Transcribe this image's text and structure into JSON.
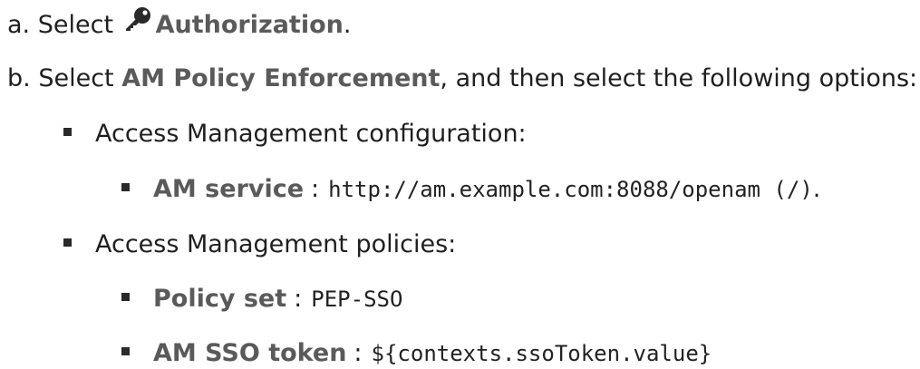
{
  "steps": {
    "a": {
      "marker": "a.",
      "prefix": "Select",
      "icon": "key-icon",
      "target": "Authorization",
      "suffix": "."
    },
    "b": {
      "marker": "b.",
      "prefix": "Select",
      "target": "AM Policy Enforcement",
      "suffix": ", and then select the following options:"
    }
  },
  "options": [
    {
      "label": "Access Management configuration:",
      "items": [
        {
          "name": "AM service",
          "separator": ":",
          "value": "http://am.example.com:8088/openam (/)",
          "end": "."
        }
      ]
    },
    {
      "label": "Access Management policies:",
      "items": [
        {
          "name": "Policy set",
          "separator": ":",
          "value": "PEP-SSO",
          "end": ""
        },
        {
          "name": "AM SSO token",
          "separator": ":",
          "value": "${contexts.ssoToken.value}",
          "end": ""
        }
      ]
    }
  ]
}
